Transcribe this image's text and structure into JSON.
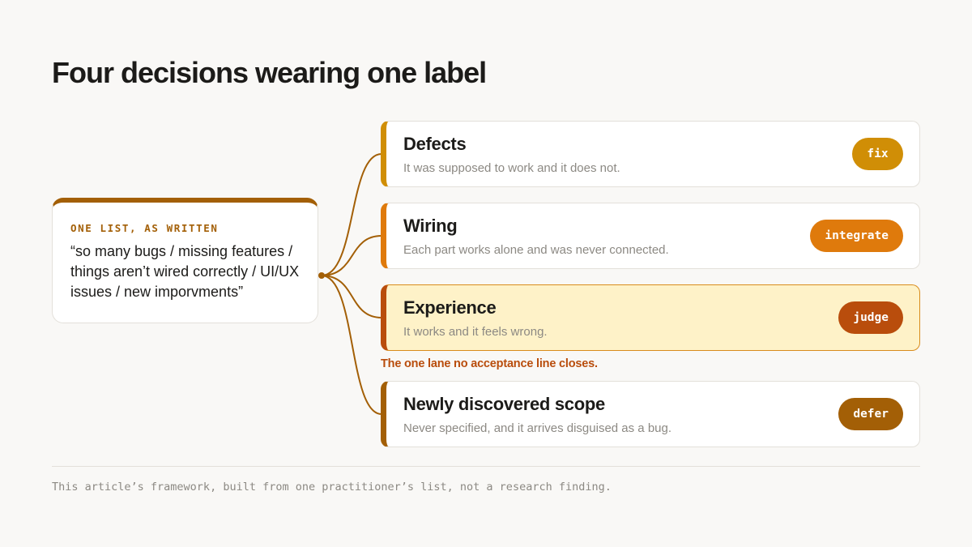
{
  "title": "Four decisions wearing one label",
  "source": {
    "label": "ONE LIST, AS WRITTEN",
    "quote": "“so many bugs / missing features / things aren’t wired correctly / UI/UX issues / new imporvments”"
  },
  "lanes": [
    {
      "title": "Defects",
      "description": "It was supposed to work and it does not.",
      "action": "fix",
      "color": "#d08e06"
    },
    {
      "title": "Wiring",
      "description": "Each part works alone and was never connected.",
      "action": "integrate",
      "color": "#df7a0c"
    },
    {
      "title": "Experience",
      "description": "It works and it feels wrong.",
      "action": "judge",
      "color": "#b94d0c",
      "highlight": true,
      "note": "The one lane no acceptance line closes."
    },
    {
      "title": "Newly discovered scope",
      "description": "Never specified, and it arrives disguised as a bug.",
      "action": "defer",
      "color": "#a35f06"
    }
  ],
  "connector_color": "#a35f06",
  "footnote": "This article’s framework, built from one practitioner’s list, not a research finding."
}
